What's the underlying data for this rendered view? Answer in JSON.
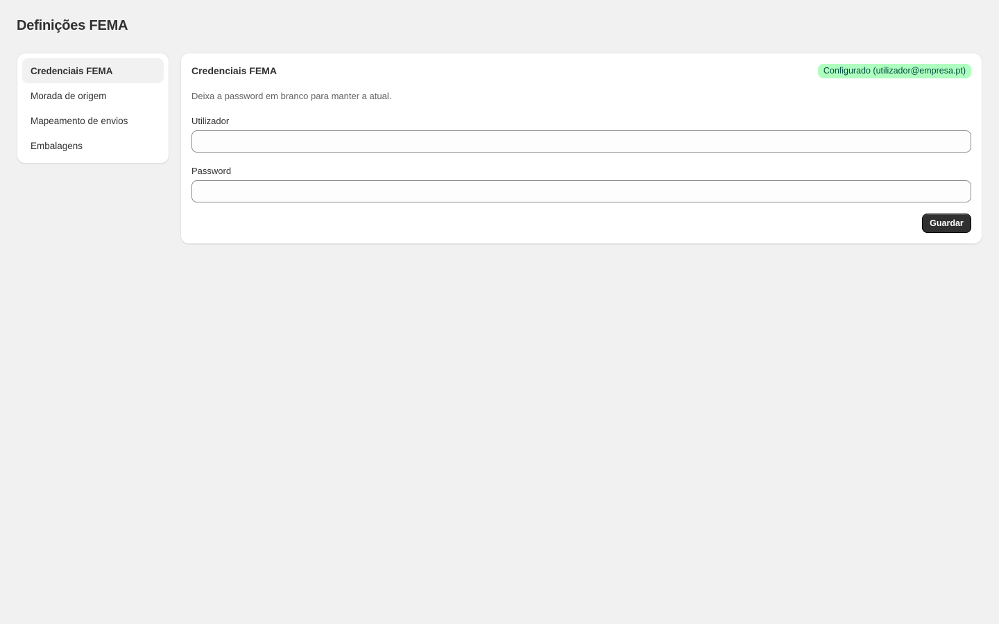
{
  "page": {
    "title": "Definições FEMA"
  },
  "sidebar": {
    "items": [
      {
        "label": "Credenciais FEMA",
        "active": true
      },
      {
        "label": "Morada de origem",
        "active": false
      },
      {
        "label": "Mapeamento de envios",
        "active": false
      },
      {
        "label": "Embalagens",
        "active": false
      }
    ]
  },
  "credentials": {
    "title": "Credenciais FEMA",
    "status_badge": "Configurado (utilizador@empresa.pt)",
    "hint": "Deixa a password em branco para manter a atual.",
    "username_label": "Utilizador",
    "username_value": "",
    "password_label": "Password",
    "password_value": "",
    "save_label": "Guardar"
  },
  "colors": {
    "background": "#f1f1f1",
    "badge_bg": "#affebf",
    "badge_text": "#014b40",
    "primary_button": "#303030"
  }
}
